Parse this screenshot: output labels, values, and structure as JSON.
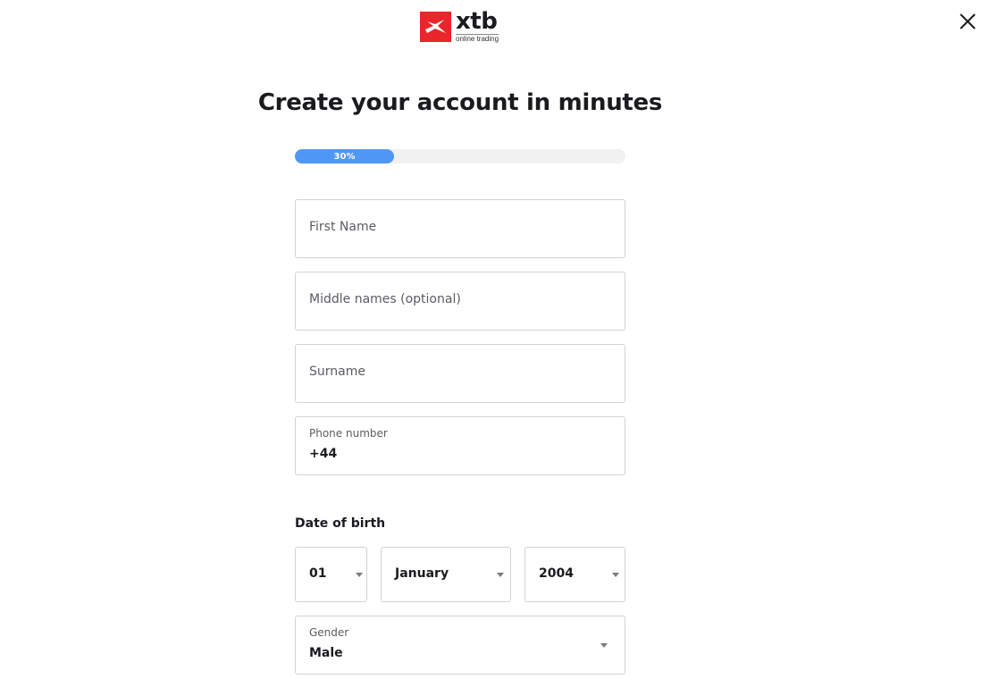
{
  "header": {
    "logo": {
      "brand": "xtb",
      "tagline": "online trading",
      "brand_color": "#e8262b",
      "icon": "xtb-x-logo-icon"
    },
    "close_icon": "close-icon"
  },
  "main": {
    "title": "Create your account in minutes",
    "progress": {
      "percent": 30,
      "label": "30%",
      "color": "#4f97f5"
    },
    "fields": {
      "first_name": {
        "placeholder": "First Name",
        "value": ""
      },
      "middle_names": {
        "placeholder": "Middle names (optional)",
        "value": ""
      },
      "surname": {
        "placeholder": "Surname",
        "value": ""
      },
      "phone": {
        "label": "Phone number",
        "value": "+44"
      }
    },
    "date_of_birth": {
      "label": "Date of birth",
      "day": "01",
      "month": "January",
      "year": "2004"
    },
    "gender": {
      "label": "Gender",
      "value": "Male"
    }
  }
}
